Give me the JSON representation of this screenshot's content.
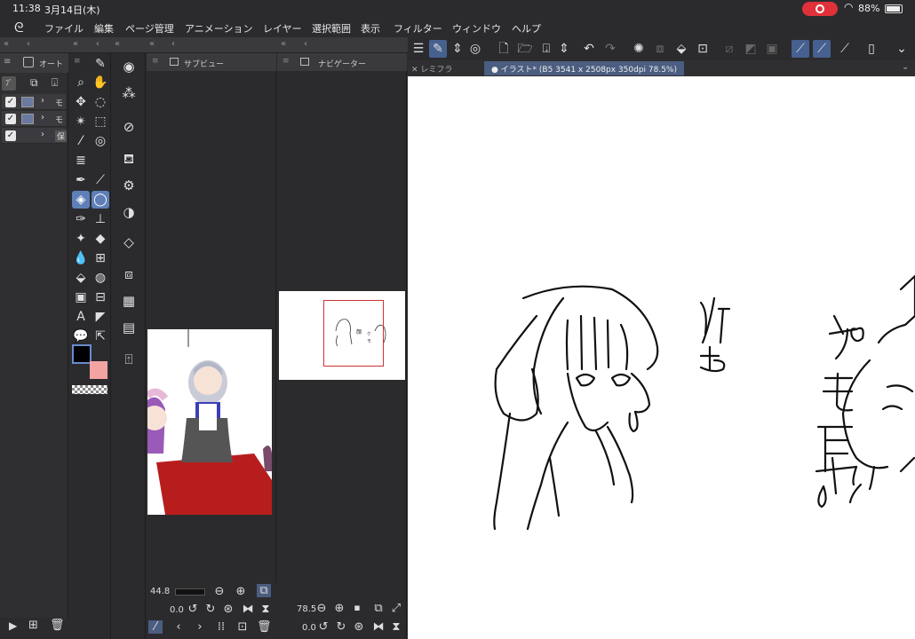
{
  "status_bar": {
    "time": "11:38",
    "date": "3月14日(木)",
    "battery": "88%"
  },
  "menu": {
    "items": [
      "ファイル",
      "編集",
      "ページ管理",
      "アニメーション",
      "レイヤー",
      "選択範囲",
      "表示",
      "フィルター",
      "ウィンドウ",
      "ヘルプ"
    ]
  },
  "layer_panel": {
    "tab_label": "オート",
    "layers": [
      {
        "name": "モ",
        "checked": true
      },
      {
        "name": "モ",
        "checked": true
      },
      {
        "name": "保",
        "checked": true
      }
    ]
  },
  "subview": {
    "title": "サブビュー",
    "zoom": "44.8",
    "rotation": "0.0"
  },
  "navigator": {
    "title": "ナビゲーター",
    "zoom": "78.5",
    "rotation": "0.0"
  },
  "canvas_tabs": {
    "inactive": "レミフラ",
    "active": "イラスト* (B5 3541 x 2508px 350dpi 78.5%)"
  },
  "artwork": {
    "text_left": [
      "顔",
      "は"
    ],
    "text_right": [
      "ケ",
      "モ",
      "耳",
      "!"
    ]
  },
  "colors": {
    "main_color": "#000000",
    "sub_color": "#f4a3a3",
    "accent": "#5e7fb8"
  }
}
